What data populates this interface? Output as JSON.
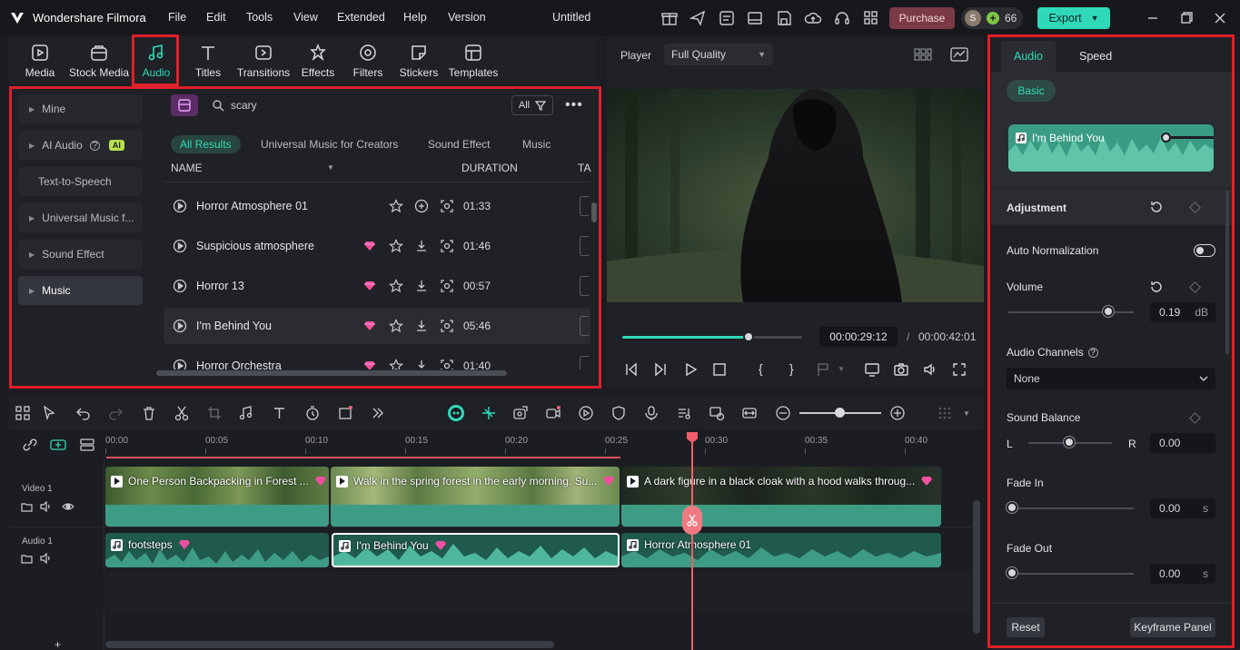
{
  "app": {
    "name": "Wondershare Filmora",
    "project_title": "Untitled",
    "menu": [
      "File",
      "Edit",
      "Tools",
      "View",
      "Extended",
      "Help",
      "Version"
    ],
    "purchase_label": "Purchase",
    "avatar_letter": "S",
    "credits": "66",
    "export_label": "Export"
  },
  "media_tabs": [
    {
      "label": "Media",
      "icon": "media-icon"
    },
    {
      "label": "Stock Media",
      "icon": "stock-media-icon"
    },
    {
      "label": "Audio",
      "icon": "music-note-icon",
      "active": true
    },
    {
      "label": "Titles",
      "icon": "titles-icon"
    },
    {
      "label": "Transitions",
      "icon": "transitions-icon"
    },
    {
      "label": "Effects",
      "icon": "effects-icon"
    },
    {
      "label": "Filters",
      "icon": "filters-icon"
    },
    {
      "label": "Stickers",
      "icon": "stickers-icon"
    },
    {
      "label": "Templates",
      "icon": "templates-icon"
    }
  ],
  "library": {
    "sidebar": [
      "Mine",
      "AI Audio",
      "Text-to-Speech",
      "Universal Music f...",
      "Sound Effect",
      "Music"
    ],
    "ai_badge": "AI",
    "search_value": "scary",
    "filter_all": "All",
    "filters": [
      "All Results",
      "Universal Music for Creators",
      "Sound Effect",
      "Music"
    ],
    "columns": {
      "name": "NAME",
      "duration": "DURATION",
      "tag": "TA"
    },
    "rows": [
      {
        "name": "Horror Atmosphere 01",
        "duration": "01:33",
        "premium": false
      },
      {
        "name": "Suspicious atmosphere",
        "duration": "01:46",
        "premium": true
      },
      {
        "name": "Horror 13",
        "duration": "00:57",
        "premium": true
      },
      {
        "name": "I'm Behind You",
        "duration": "05:46",
        "premium": true
      },
      {
        "name": "Horror Orchestra",
        "duration": "01:40",
        "premium": true
      }
    ]
  },
  "player": {
    "label": "Player",
    "quality": "Full Quality",
    "current_time": "00:00:29:12",
    "separator": "/",
    "total_time": "00:00:42:01",
    "progress_fraction": 0.7,
    "bracket_in": "{",
    "bracket_out": "}"
  },
  "timeline": {
    "ruler": [
      "00:00",
      "00:05",
      "00:10",
      "00:15",
      "00:20",
      "00:25",
      "00:30",
      "00:35",
      "00:40"
    ],
    "video_track": "Video 1",
    "audio_track": "Audio 1",
    "video_clips": [
      "One Person Backpacking in Forest ...",
      "Walk in the spring forest in the early morning. Su...",
      "A dark figure in a black cloak with a hood walks throug..."
    ],
    "audio_clips": [
      "footsteps",
      "I'm Behind You",
      "Horror Atmosphere 01"
    ]
  },
  "audio_panel": {
    "tabs": [
      "Audio",
      "Speed"
    ],
    "basic_label": "Basic",
    "clip_name": "I'm Behind You",
    "adjustment": "Adjustment",
    "auto_normalization": "Auto Normalization",
    "volume": "Volume",
    "volume_value": "0.19",
    "volume_unit": "dB",
    "audio_channels": "Audio Channels",
    "channel_value": "None",
    "sound_balance": "Sound Balance",
    "balance_left": "L",
    "balance_right": "R",
    "balance_value": "0.00",
    "fade_in": "Fade In",
    "fade_in_value": "0.00",
    "fade_out": "Fade Out",
    "fade_out_value": "0.00",
    "seconds_unit": "s",
    "reset": "Reset",
    "keyframe_panel": "Keyframe Panel"
  },
  "colors": {
    "accent": "#2fd9b8",
    "highlight_box": "#e0202a",
    "playhead": "#f0606a",
    "premium": "#f050a0"
  }
}
